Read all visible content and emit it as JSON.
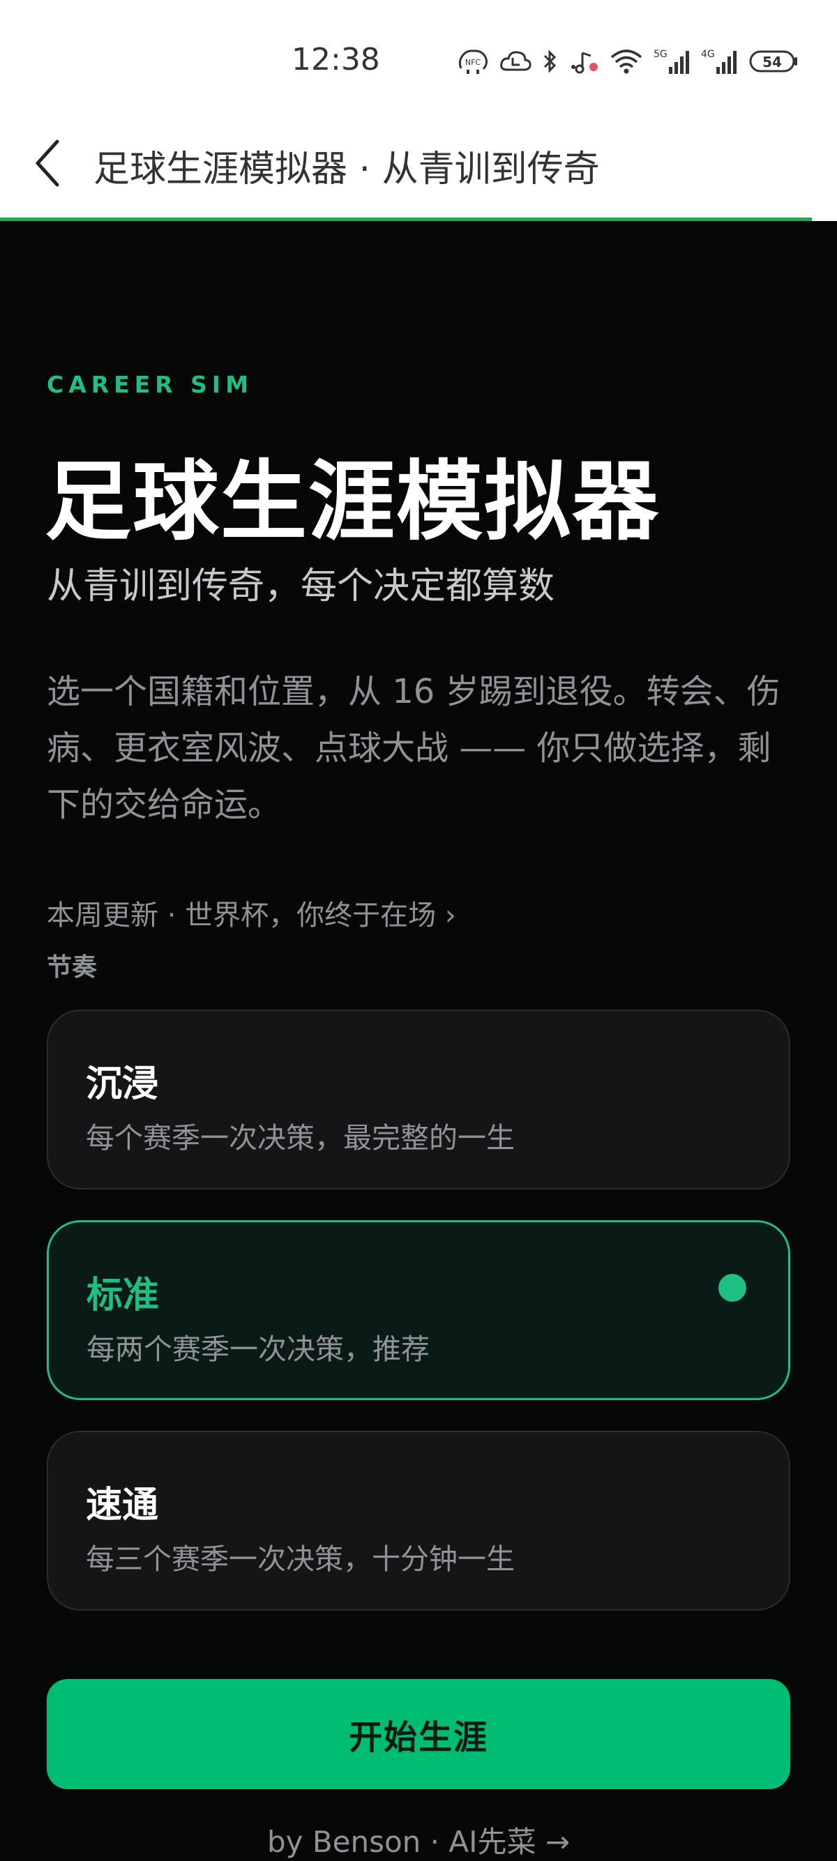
{
  "status_bar": {
    "time": "12:38",
    "icons": [
      "nfc-icon",
      "cloud-icon",
      "bluetooth-icon",
      "music-icon",
      "wifi-icon",
      "signal-5g-icon",
      "signal-4g-icon",
      "battery-icon"
    ],
    "labels": {
      "nfc": "NFC",
      "g5": "5G",
      "g4": "4G",
      "battery": "54"
    }
  },
  "nav": {
    "back_icon": "chevron-left-icon",
    "title": "足球生涯模拟器 · 从青训到传奇",
    "progress": 0.97,
    "progress_color": "#22a94a"
  },
  "hero": {
    "kicker": "CAREER SIM",
    "title": "足球生涯模拟器",
    "subtitle": "从青训到传奇，每个决定都算数",
    "description": "选一个国籍和位置，从 16 岁踢到退役。转会、伤病、更衣室风波、点球大战 —— 你只做选择，剩下的交给命运。",
    "update_link": "本周更新 · 世界杯，你终于在场 ›"
  },
  "pace": {
    "label": "节奏",
    "options": [
      {
        "title": "沉浸",
        "desc": "每个赛季一次决策，最完整的一生",
        "selected": false
      },
      {
        "title": "标准",
        "desc": "每两个赛季一次决策，推荐",
        "selected": true
      },
      {
        "title": "速通",
        "desc": "每三个赛季一次决策，十分钟一生",
        "selected": false
      }
    ]
  },
  "start_button": {
    "label": "开始生涯"
  },
  "footer": {
    "text": "by Benson · AI先菜 →"
  },
  "colors": {
    "accent": "#1fbf83",
    "button": "#00bd73",
    "background": "#060707"
  }
}
